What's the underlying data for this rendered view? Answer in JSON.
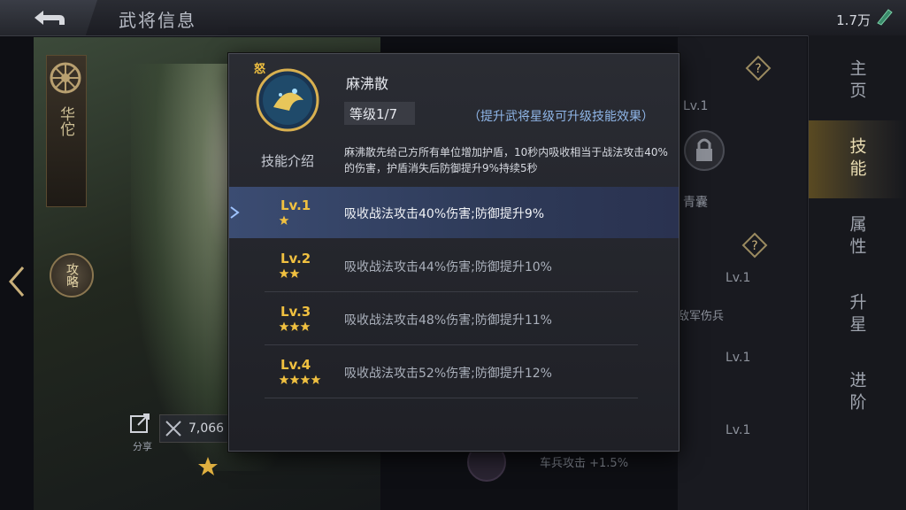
{
  "header": {
    "title": "武将信息",
    "currency": "1.7万"
  },
  "right_nav": {
    "items": [
      {
        "label": "主页"
      },
      {
        "label": "技能",
        "active": true
      },
      {
        "label": "属性"
      },
      {
        "label": "升星"
      },
      {
        "label": "进阶"
      }
    ]
  },
  "hero": {
    "name": "华佗",
    "strategy_label": "攻略",
    "share_label": "分享",
    "power": "7,066"
  },
  "background": {
    "lv": "Lv.1",
    "qingnang": "青囊",
    "damage_text": "敌军伤兵",
    "car_text": "车兵攻击 +1.5%"
  },
  "popup": {
    "tag": "怒",
    "skill_name": "麻沸散",
    "level": "等级1/7",
    "hint": "（提升武将星级可升级技能效果）",
    "intro_label": "技能介绍",
    "intro_text": "麻沸散先给己方所有单位增加护盾，10秒内吸收相当于战法攻击40%的伤害，护盾消失后防御提升9%持续5秒",
    "levels": [
      {
        "label": "Lv.1",
        "stars": 1,
        "desc": "吸收战法攻击40%伤害;防御提升9%",
        "active": true
      },
      {
        "label": "Lv.2",
        "stars": 2,
        "desc": "吸收战法攻击44%伤害;防御提升10%"
      },
      {
        "label": "Lv.3",
        "stars": 3,
        "desc": "吸收战法攻击48%伤害;防御提升11%"
      },
      {
        "label": "Lv.4",
        "stars": 4,
        "desc": "吸收战法攻击52%伤害;防御提升12%"
      }
    ]
  },
  "colors": {
    "accent_gold": "#f0c040",
    "active_row": "#2e3a58",
    "hint_blue": "#8fb6e8"
  }
}
